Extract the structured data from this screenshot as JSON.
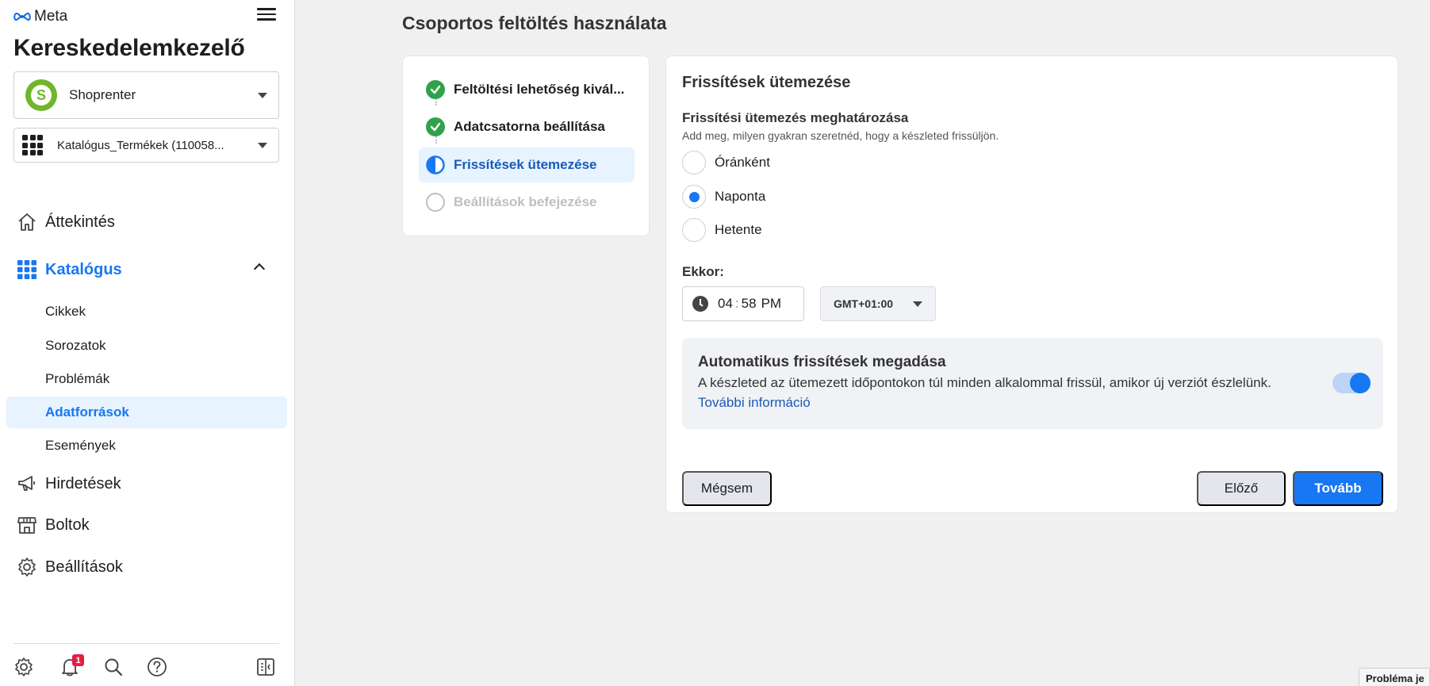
{
  "sidebar": {
    "brand": "Meta",
    "app_title": "Kereskedelemkezelő",
    "business": {
      "name": "Shoprenter",
      "logo_color": "#6fb62c"
    },
    "catalog": {
      "name": "Katalógus_Termékek (110058..."
    },
    "nav": [
      {
        "label": "Áttekintés",
        "icon": "home-icon"
      },
      {
        "label": "Katalógus",
        "icon": "grid-icon",
        "expanded": true
      },
      {
        "label": "Hirdetések",
        "icon": "megaphone-icon"
      },
      {
        "label": "Boltok",
        "icon": "store-icon"
      },
      {
        "label": "Beállítások",
        "icon": "gear-icon"
      }
    ],
    "catalog_sub": [
      {
        "label": "Cikkek"
      },
      {
        "label": "Sorozatok"
      },
      {
        "label": "Problémák"
      },
      {
        "label": "Adatforrások",
        "selected": true
      },
      {
        "label": "Események"
      }
    ],
    "footer": {
      "notification_count": "1"
    }
  },
  "page": {
    "title": "Csoportos feltöltés használata"
  },
  "steps": [
    {
      "label": "Feltöltési lehetőség kivál...",
      "status": "done"
    },
    {
      "label": "Adatcsatorna beállítása",
      "status": "done"
    },
    {
      "label": "Frissítések ütemezése",
      "status": "current"
    },
    {
      "label": "Beállítások befejezése",
      "status": "pending"
    }
  ],
  "schedule": {
    "card_title": "Frissítések ütemezése",
    "section_label": "Frissítési ütemezés meghatározása",
    "section_desc": "Add meg, milyen gyakran szeretnéd, hogy a készleted frissüljön.",
    "options": [
      {
        "label": "Óránként",
        "checked": false
      },
      {
        "label": "Naponta",
        "checked": true
      },
      {
        "label": "Hetente",
        "checked": false
      }
    ],
    "time_label": "Ekkor:",
    "time": {
      "hour": "04",
      "sep": ":",
      "minute": "58",
      "ampm": "PM"
    },
    "timezone": "GMT+01:00",
    "auto": {
      "title": "Automatikus frissítések megadása",
      "desc": "A készleted az ütemezett időpontokon túl minden alkalommal frissül, amikor új verziót észlelünk.",
      "link": "További információ",
      "enabled": true
    },
    "buttons": {
      "cancel": "Mégsem",
      "prev": "Előző",
      "next": "Tovább"
    }
  },
  "help_tab": "Probléma je",
  "colors": {
    "accent": "#1877f2",
    "success": "#31a24c",
    "selected_bg": "#e7f3ff"
  }
}
